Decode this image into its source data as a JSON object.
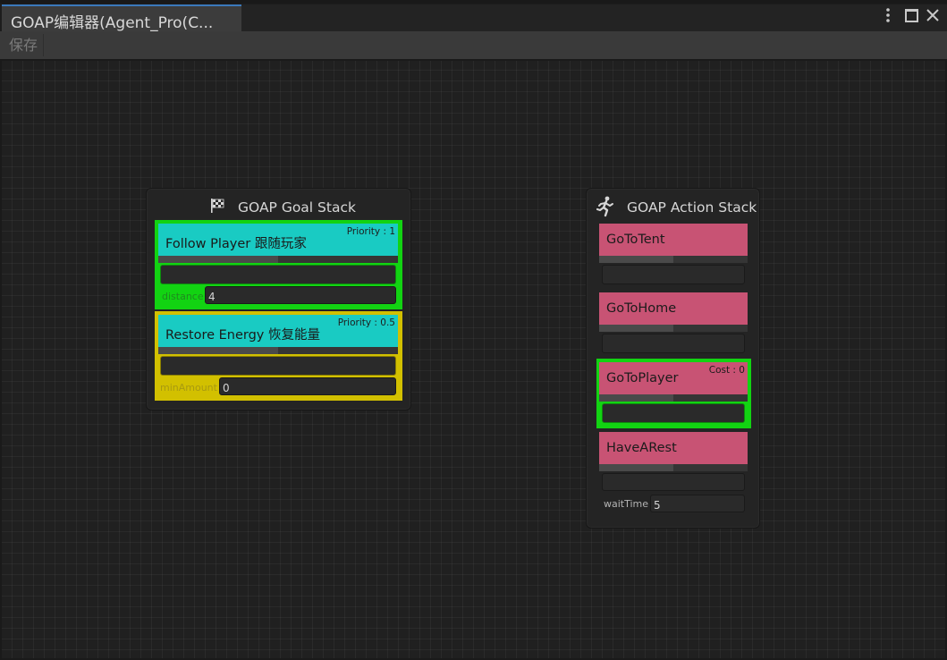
{
  "window": {
    "tab_title": "GOAP编辑器(Agent_Pro(C...",
    "menu_icon": "more-vertical-icon",
    "maximize_icon": "maximize-icon",
    "close_icon": "close-icon"
  },
  "toolbar": {
    "save_label": "保存"
  },
  "goal_stack": {
    "title": "GOAP Goal Stack",
    "icon": "checkered-flag-icon",
    "goals": [
      {
        "name": "Follow Player 跟随玩家",
        "priority": "Priority : 1",
        "field_label": "distance",
        "field_value": "4",
        "highlight": "#12d312"
      },
      {
        "name": "Restore Energy 恢复能量",
        "priority": "Priority : 0.5",
        "field_label": "minAmount",
        "field_value": "0",
        "highlight": "#d2c000"
      }
    ]
  },
  "action_stack": {
    "title": "GOAP Action Stack",
    "icon": "running-person-icon",
    "actions": [
      {
        "name": "GoToTent"
      },
      {
        "name": "GoToHome"
      },
      {
        "name": "GoToPlayer",
        "cost": "Cost : 0",
        "highlight": "#12d312"
      },
      {
        "name": "HaveARest",
        "field_label": "waitTime",
        "field_value": "5"
      }
    ]
  },
  "colors": {
    "goal_header": "#19cbc3",
    "action_header": "#c85374",
    "active_green": "#12d312",
    "pending_yellow": "#d2c000",
    "tab_accent": "#3a79bb"
  }
}
